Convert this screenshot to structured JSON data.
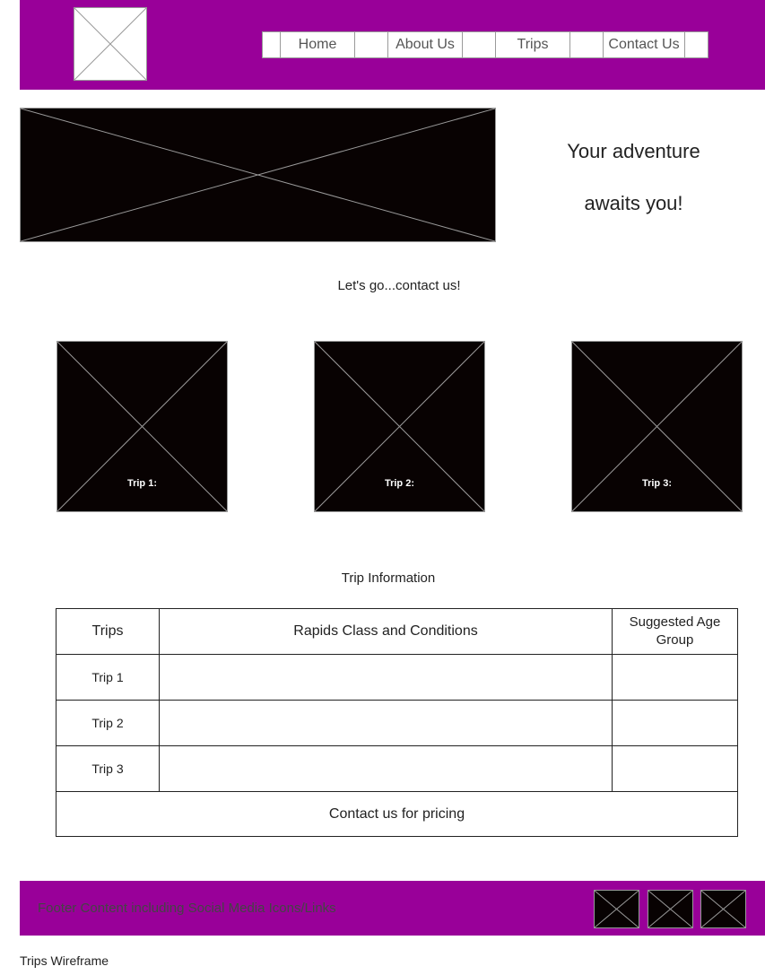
{
  "nav": {
    "items": [
      {
        "label": "Home"
      },
      {
        "label": "About Us"
      },
      {
        "label": "Trips"
      },
      {
        "label": "Contact Us"
      }
    ]
  },
  "hero": {
    "tagline_line1": "Your adventure",
    "tagline_line2": "awaits you!"
  },
  "cta": {
    "text": "Let's go...contact us!"
  },
  "trips": [
    {
      "label": "Trip 1:"
    },
    {
      "label": "Trip 2:"
    },
    {
      "label": "Trip 3:"
    }
  ],
  "trip_info": {
    "title": "Trip Information",
    "headers": [
      "Trips",
      "Rapids Class and Conditions",
      "Suggested Age Group"
    ],
    "rows": [
      {
        "trip": "Trip 1",
        "rapids": "",
        "age": ""
      },
      {
        "trip": "Trip 2",
        "rapids": "",
        "age": ""
      },
      {
        "trip": "Trip 3",
        "rapids": "",
        "age": ""
      }
    ],
    "footer_note": "Contact us for pricing"
  },
  "footer": {
    "text": "Footer Content including Social Media Icons/Links",
    "social_icons": [
      "social-icon",
      "social-icon",
      "social-icon"
    ]
  },
  "caption": "Trips Wireframe",
  "colors": {
    "header_bg": "#990099",
    "footer_bg": "#990099",
    "placeholder_fill": "#080202"
  }
}
